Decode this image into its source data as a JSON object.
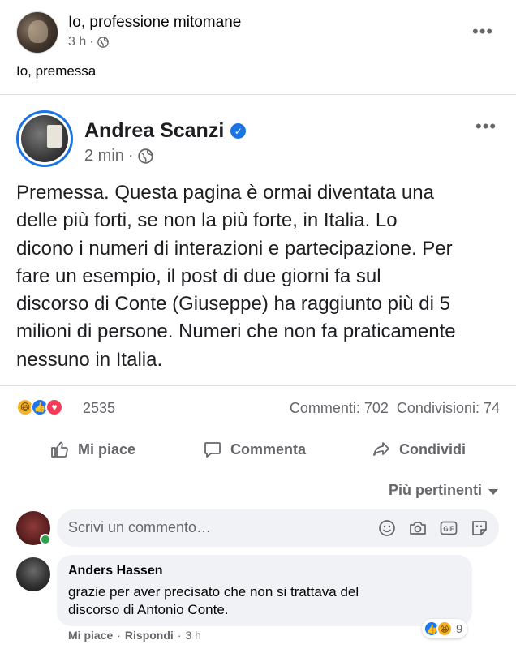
{
  "outer_post": {
    "author": "Io, professione mitomane",
    "time": "3 h",
    "privacy_icon": "globe-icon",
    "caption": "Io, premessa"
  },
  "shared_post": {
    "author": "Andrea Scanzi",
    "verified": true,
    "time": "2 min",
    "privacy_icon": "globe-icon",
    "text_lines": [
      "Premessa. Questa pagina è ormai diventata una",
      "delle più forti, se non la più forte, in Italia. Lo",
      "dicono i numeri di interazioni e partecipazione. Per",
      "fare un esempio, il post di due giorni fa sul",
      "discorso di Conte (Giuseppe) ha raggiunto più di 5",
      "milioni di persone. Numeri che non fa praticamente",
      "nessuno in Italia."
    ]
  },
  "stats": {
    "reaction_icons": [
      "haha-reaction-icon",
      "like-reaction-icon",
      "love-reaction-icon"
    ],
    "reaction_count": "2535",
    "comments": "Commenti: 702",
    "shares": "Condivisioni: 74"
  },
  "actions": {
    "like": "Mi piace",
    "comment": "Commenta",
    "share": "Condividi"
  },
  "comments_sort": {
    "label": "Più pertinenti"
  },
  "composer": {
    "placeholder": "Scrivi un commento…"
  },
  "comment": {
    "author": "Anders Hassen",
    "text_lines": [
      "grazie per aver precisato che non si trattava del",
      "discorso di Antonio Conte."
    ],
    "like_label": "Mi piace",
    "reply_label": "Rispondi",
    "separator": "·",
    "time": "3 h",
    "reaction_count": "9"
  },
  "colors": {
    "accent_blue": "#1b74e4",
    "secondary_text": "#65676b",
    "bubble_bg": "#f0f2f5",
    "online_green": "#31a24c"
  }
}
